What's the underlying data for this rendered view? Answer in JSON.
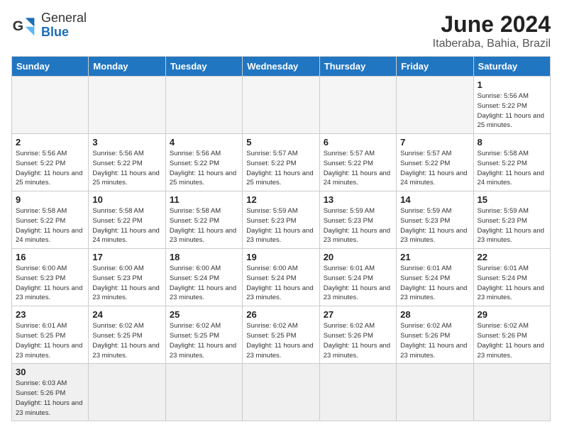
{
  "header": {
    "logo_general": "General",
    "logo_blue": "Blue",
    "month_title": "June 2024",
    "location": "Itaberaba, Bahia, Brazil"
  },
  "weekdays": [
    "Sunday",
    "Monday",
    "Tuesday",
    "Wednesday",
    "Thursday",
    "Friday",
    "Saturday"
  ],
  "days": [
    {
      "date": "",
      "empty": true
    },
    {
      "date": "",
      "empty": true
    },
    {
      "date": "",
      "empty": true
    },
    {
      "date": "",
      "empty": true
    },
    {
      "date": "",
      "empty": true
    },
    {
      "date": "",
      "empty": true
    },
    {
      "date": "1",
      "sunrise": "Sunrise: 5:56 AM",
      "sunset": "Sunset: 5:22 PM",
      "daylight": "Daylight: 11 hours and 25 minutes."
    },
    {
      "date": "2",
      "sunrise": "Sunrise: 5:56 AM",
      "sunset": "Sunset: 5:22 PM",
      "daylight": "Daylight: 11 hours and 25 minutes."
    },
    {
      "date": "3",
      "sunrise": "Sunrise: 5:56 AM",
      "sunset": "Sunset: 5:22 PM",
      "daylight": "Daylight: 11 hours and 25 minutes."
    },
    {
      "date": "4",
      "sunrise": "Sunrise: 5:56 AM",
      "sunset": "Sunset: 5:22 PM",
      "daylight": "Daylight: 11 hours and 25 minutes."
    },
    {
      "date": "5",
      "sunrise": "Sunrise: 5:57 AM",
      "sunset": "Sunset: 5:22 PM",
      "daylight": "Daylight: 11 hours and 25 minutes."
    },
    {
      "date": "6",
      "sunrise": "Sunrise: 5:57 AM",
      "sunset": "Sunset: 5:22 PM",
      "daylight": "Daylight: 11 hours and 24 minutes."
    },
    {
      "date": "7",
      "sunrise": "Sunrise: 5:57 AM",
      "sunset": "Sunset: 5:22 PM",
      "daylight": "Daylight: 11 hours and 24 minutes."
    },
    {
      "date": "8",
      "sunrise": "Sunrise: 5:58 AM",
      "sunset": "Sunset: 5:22 PM",
      "daylight": "Daylight: 11 hours and 24 minutes."
    },
    {
      "date": "9",
      "sunrise": "Sunrise: 5:58 AM",
      "sunset": "Sunset: 5:22 PM",
      "daylight": "Daylight: 11 hours and 24 minutes."
    },
    {
      "date": "10",
      "sunrise": "Sunrise: 5:58 AM",
      "sunset": "Sunset: 5:22 PM",
      "daylight": "Daylight: 11 hours and 24 minutes."
    },
    {
      "date": "11",
      "sunrise": "Sunrise: 5:58 AM",
      "sunset": "Sunset: 5:22 PM",
      "daylight": "Daylight: 11 hours and 23 minutes."
    },
    {
      "date": "12",
      "sunrise": "Sunrise: 5:59 AM",
      "sunset": "Sunset: 5:23 PM",
      "daylight": "Daylight: 11 hours and 23 minutes."
    },
    {
      "date": "13",
      "sunrise": "Sunrise: 5:59 AM",
      "sunset": "Sunset: 5:23 PM",
      "daylight": "Daylight: 11 hours and 23 minutes."
    },
    {
      "date": "14",
      "sunrise": "Sunrise: 5:59 AM",
      "sunset": "Sunset: 5:23 PM",
      "daylight": "Daylight: 11 hours and 23 minutes."
    },
    {
      "date": "15",
      "sunrise": "Sunrise: 5:59 AM",
      "sunset": "Sunset: 5:23 PM",
      "daylight": "Daylight: 11 hours and 23 minutes."
    },
    {
      "date": "16",
      "sunrise": "Sunrise: 6:00 AM",
      "sunset": "Sunset: 5:23 PM",
      "daylight": "Daylight: 11 hours and 23 minutes."
    },
    {
      "date": "17",
      "sunrise": "Sunrise: 6:00 AM",
      "sunset": "Sunset: 5:23 PM",
      "daylight": "Daylight: 11 hours and 23 minutes."
    },
    {
      "date": "18",
      "sunrise": "Sunrise: 6:00 AM",
      "sunset": "Sunset: 5:24 PM",
      "daylight": "Daylight: 11 hours and 23 minutes."
    },
    {
      "date": "19",
      "sunrise": "Sunrise: 6:00 AM",
      "sunset": "Sunset: 5:24 PM",
      "daylight": "Daylight: 11 hours and 23 minutes."
    },
    {
      "date": "20",
      "sunrise": "Sunrise: 6:01 AM",
      "sunset": "Sunset: 5:24 PM",
      "daylight": "Daylight: 11 hours and 23 minutes."
    },
    {
      "date": "21",
      "sunrise": "Sunrise: 6:01 AM",
      "sunset": "Sunset: 5:24 PM",
      "daylight": "Daylight: 11 hours and 23 minutes."
    },
    {
      "date": "22",
      "sunrise": "Sunrise: 6:01 AM",
      "sunset": "Sunset: 5:24 PM",
      "daylight": "Daylight: 11 hours and 23 minutes."
    },
    {
      "date": "23",
      "sunrise": "Sunrise: 6:01 AM",
      "sunset": "Sunset: 5:25 PM",
      "daylight": "Daylight: 11 hours and 23 minutes."
    },
    {
      "date": "24",
      "sunrise": "Sunrise: 6:02 AM",
      "sunset": "Sunset: 5:25 PM",
      "daylight": "Daylight: 11 hours and 23 minutes."
    },
    {
      "date": "25",
      "sunrise": "Sunrise: 6:02 AM",
      "sunset": "Sunset: 5:25 PM",
      "daylight": "Daylight: 11 hours and 23 minutes."
    },
    {
      "date": "26",
      "sunrise": "Sunrise: 6:02 AM",
      "sunset": "Sunset: 5:25 PM",
      "daylight": "Daylight: 11 hours and 23 minutes."
    },
    {
      "date": "27",
      "sunrise": "Sunrise: 6:02 AM",
      "sunset": "Sunset: 5:26 PM",
      "daylight": "Daylight: 11 hours and 23 minutes."
    },
    {
      "date": "28",
      "sunrise": "Sunrise: 6:02 AM",
      "sunset": "Sunset: 5:26 PM",
      "daylight": "Daylight: 11 hours and 23 minutes."
    },
    {
      "date": "29",
      "sunrise": "Sunrise: 6:02 AM",
      "sunset": "Sunset: 5:26 PM",
      "daylight": "Daylight: 11 hours and 23 minutes."
    },
    {
      "date": "30",
      "sunrise": "Sunrise: 6:03 AM",
      "sunset": "Sunset: 5:26 PM",
      "daylight": "Daylight: 11 hours and 23 minutes."
    }
  ]
}
